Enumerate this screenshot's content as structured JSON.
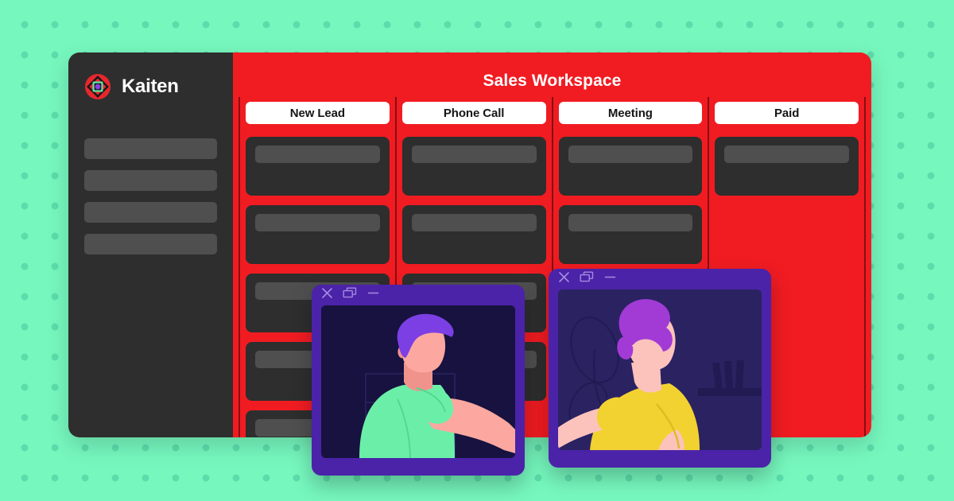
{
  "background": {
    "color": "#76F7BE",
    "dot_color": "#56D8A8",
    "pattern": "dot-grid"
  },
  "app": {
    "accent_color": "#F01C22",
    "panel_color": "#2E2E2E",
    "placeholder_color": "#4F4F4F"
  },
  "sidebar": {
    "brand_name": "Kaiten",
    "logo_icon": "kaiten-logo-icon",
    "logo_colors": {
      "ring": "#E8272D",
      "diamond": "#5BE8A8",
      "center": "#8B3FE8"
    },
    "placeholder_items": [
      {
        "label": ""
      },
      {
        "label": ""
      },
      {
        "label": ""
      },
      {
        "label": ""
      }
    ]
  },
  "board": {
    "title": "Sales Workspace",
    "columns": [
      {
        "name": "New Lead",
        "cards": [
          {},
          {},
          {},
          {},
          {}
        ]
      },
      {
        "name": "Phone Call",
        "cards": [
          {},
          {},
          {},
          {}
        ]
      },
      {
        "name": "Meeting",
        "cards": [
          {},
          {},
          {}
        ]
      },
      {
        "name": "Paid",
        "cards": [
          {}
        ]
      }
    ]
  },
  "video_windows": [
    {
      "id": "left",
      "frame_color": "#4B23A8",
      "screen_color": "#17123F",
      "controls": [
        {
          "icon": "close-icon",
          "glyph": "✕"
        },
        {
          "icon": "restore-icon",
          "glyph": "❐"
        },
        {
          "icon": "minimize-icon",
          "glyph": "—"
        }
      ],
      "person": {
        "description": "man-green-shirt",
        "hair_color": "#7B3FE4",
        "shirt_color": "#6BEFA8",
        "skin_color": "#FCA8A0"
      }
    },
    {
      "id": "right",
      "frame_color": "#4B23A8",
      "screen_color": "#2B2262",
      "controls": [
        {
          "icon": "close-icon",
          "glyph": "✕"
        },
        {
          "icon": "restore-icon",
          "glyph": "❐"
        },
        {
          "icon": "minimize-icon",
          "glyph": "—"
        }
      ],
      "person": {
        "description": "woman-yellow-sweater",
        "hair_color": "#A23BD6",
        "shirt_color": "#F2D230",
        "skin_color": "#FBC3BC"
      }
    }
  ]
}
